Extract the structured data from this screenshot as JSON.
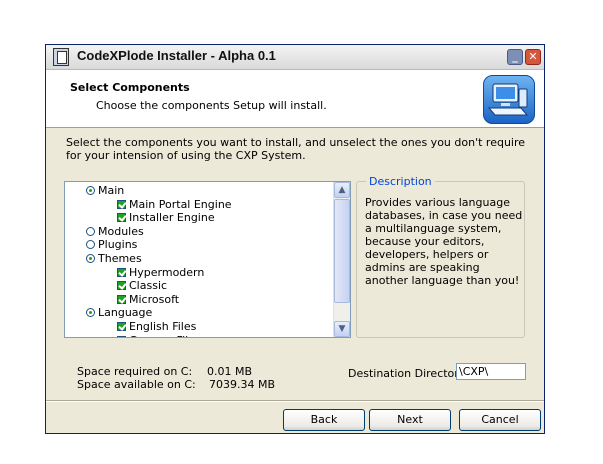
{
  "window": {
    "title": "CodeXPlode Installer - Alpha 0.1",
    "controls": [
      "minimize-icon",
      "close-icon"
    ]
  },
  "header": {
    "title": "Select Components",
    "subtitle": "Choose the components Setup will install."
  },
  "intro": "Select the components you want to install, and unselect the ones you don't require for your intension of using the CXP System.",
  "tree": {
    "items": [
      {
        "label": "Main",
        "type": "radio",
        "checked": true,
        "level": 0
      },
      {
        "label": "Main Portal Engine",
        "type": "checkbox",
        "checked": true,
        "level": 1
      },
      {
        "label": "Installer Engine",
        "type": "checkbox",
        "checked": true,
        "level": 1
      },
      {
        "label": "Modules",
        "type": "radio",
        "checked": false,
        "level": 0
      },
      {
        "label": "Plugins",
        "type": "radio",
        "checked": false,
        "level": 0
      },
      {
        "label": "Themes",
        "type": "radio",
        "checked": true,
        "level": 0
      },
      {
        "label": "Hypermodern",
        "type": "checkbox",
        "checked": true,
        "level": 1
      },
      {
        "label": "Classic",
        "type": "checkbox",
        "checked": true,
        "level": 1
      },
      {
        "label": "Microsoft",
        "type": "checkbox",
        "checked": true,
        "level": 1
      },
      {
        "label": "Language",
        "type": "radio",
        "checked": true,
        "level": 0
      },
      {
        "label": "English Files",
        "type": "checkbox",
        "checked": true,
        "level": 1
      },
      {
        "label": "German Files",
        "type": "checkbox",
        "checked": true,
        "level": 1
      }
    ]
  },
  "description": {
    "legend": "Description",
    "text": "Provides various language databases, in case you need a multilanguage system, because your editors, developers, helpers or admins are speaking another language than you!"
  },
  "space": {
    "required_label": "Space required on C:",
    "required_value": "0.01 MB",
    "available_label": "Space available on C:",
    "available_value": "7039.34 MB"
  },
  "destination": {
    "label": "Destination Directory:",
    "value": "\\CXP\\"
  },
  "buttons": {
    "back": "Back",
    "next": "Next",
    "cancel": "Cancel"
  },
  "colors": {
    "window_bg": "#ece9d8",
    "accent": "#0046d5",
    "check_green": "#21a121"
  }
}
